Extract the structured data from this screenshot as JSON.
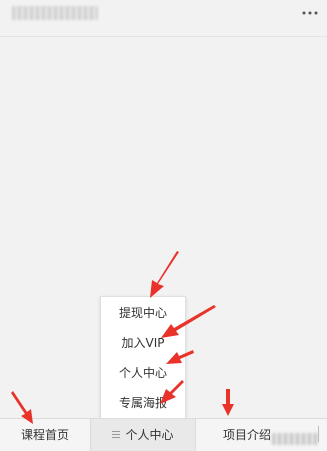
{
  "popup_menu": {
    "items": [
      {
        "label": "提现中心"
      },
      {
        "label": "加入VIP"
      },
      {
        "label": "个人中心"
      },
      {
        "label": "专属海报"
      }
    ]
  },
  "tabbar": {
    "home_label": "课程首页",
    "personal_label": "个人中心",
    "project_label": "项目介绍"
  },
  "colors": {
    "background": "#f2f2f2",
    "annotation_arrow": "#e8322a"
  },
  "icons": {
    "more": "more-dots-icon",
    "menu": "menu-lines-icon"
  }
}
